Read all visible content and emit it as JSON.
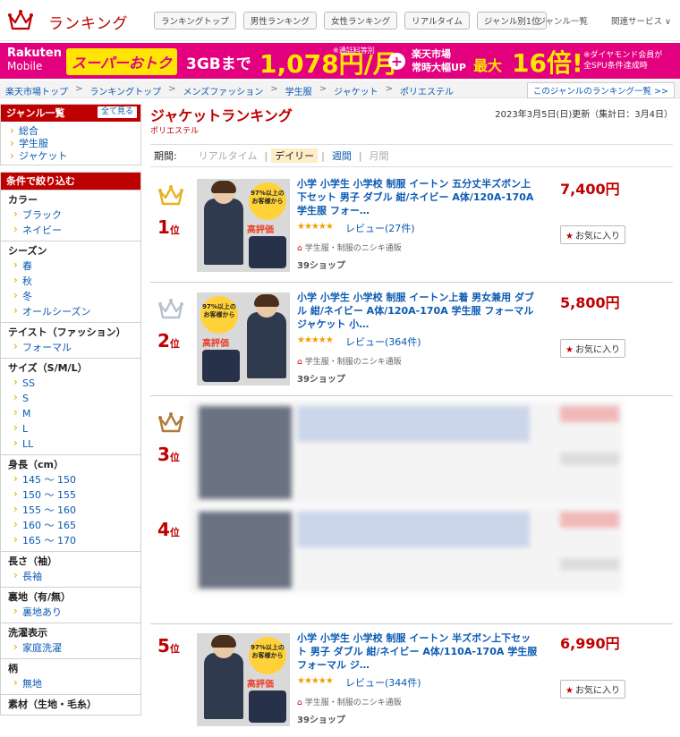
{
  "header": {
    "logo_text": "ランキング",
    "nav": [
      "ランキングトップ",
      "男性ランキング",
      "女性ランキング",
      "リアルタイム",
      "ジャンル別1位"
    ],
    "genre_list": "ジャンル一覧",
    "related": "関連サービス ∨"
  },
  "banner": {
    "mobile_line1": "Rakuten",
    "mobile_line2": "Mobile",
    "deal": "スーパーおトク",
    "gb": "3GBまで",
    "price": "1,078円/月",
    "note1": "※通話料等別",
    "plus": "+",
    "ichiba_line1": "楽天市場",
    "ichiba_line2": "常時大幅UP",
    "max": "最大",
    "times": "16倍!",
    "note2_line1": "※ダイヤモンド会員が",
    "note2_line2": "全SPU条件達成時"
  },
  "breadcrumb": {
    "items": [
      "楽天市場トップ",
      "ランキングトップ",
      "メンズファッション",
      "学生服",
      "ジャケット",
      "ポリエステル"
    ],
    "sep": ">",
    "genre_button": "このジャンルのランキング一覧 >>"
  },
  "sidebar": {
    "genre_title": "ジャンル一覧",
    "see_all": "全て見る",
    "genre_items": [
      "総合",
      "学生服",
      "ジャケット"
    ],
    "filter_title": "条件で絞り込む",
    "sections": [
      {
        "title": "カラー",
        "items": [
          "ブラック",
          "ネイビー"
        ]
      },
      {
        "title": "シーズン",
        "items": [
          "春",
          "秋",
          "冬",
          "オールシーズン"
        ]
      },
      {
        "title": "テイスト（ファッション）",
        "items": [
          "フォーマル"
        ]
      },
      {
        "title": "サイズ（S/M/L）",
        "items": [
          "SS",
          "S",
          "M",
          "L",
          "LL"
        ]
      },
      {
        "title": "身長（cm）",
        "items": [
          "145 ～ 150",
          "150 ～ 155",
          "155 ～ 160",
          "160 ～ 165",
          "165 ～ 170"
        ]
      },
      {
        "title": "長さ（袖）",
        "items": [
          "長袖"
        ]
      },
      {
        "title": "裏地（有/無）",
        "items": [
          "裏地あり"
        ]
      },
      {
        "title": "洗濯表示",
        "items": [
          "家庭洗濯"
        ]
      },
      {
        "title": "柄",
        "items": [
          "無地"
        ]
      },
      {
        "title": "素材（生地・毛糸）",
        "items": []
      }
    ]
  },
  "main": {
    "title": "ジャケットランキング",
    "subtitle": "ポリエステル",
    "updated": "2023年3月5日(日)更新（集計日：3月4日）",
    "period_label": "期間:",
    "periods": [
      "リアルタイム",
      "デイリー",
      "週間",
      "月間"
    ],
    "items": [
      {
        "rank": "1",
        "rank_suffix": "位",
        "title": "小学 小学生 小学校 制服 イートン 五分丈半ズボン上下セット 男子 ダブル 紺/ネイビー A体/120A-170A 学生服 フォー…",
        "stars": "★★★★★",
        "review": "レビュー(27件)",
        "shop": "学生服・制服のニシキ通販",
        "shop_logo": "39ショップ",
        "price": "7,400円",
        "fav": "お気に入り",
        "badge": "97%以上のお客様から",
        "badge2": "高評価",
        "crown": "gold"
      },
      {
        "rank": "2",
        "rank_suffix": "位",
        "title": "小学 小学生 小学校 制服 イートン上着 男女兼用 ダブル 紺/ネイビー A体/120A-170A 学生服 フォーマル ジャケット 小…",
        "stars": "★★★★★",
        "review": "レビュー(364件)",
        "shop": "学生服・制服のニシキ通販",
        "shop_logo": "39ショップ",
        "price": "5,800円",
        "fav": "お気に入り",
        "badge": "97%以上のお客様から",
        "badge2": "高評価",
        "crown": "silver"
      },
      {
        "rank": "3",
        "rank_suffix": "位",
        "crown": "bronze"
      },
      {
        "rank": "4",
        "rank_suffix": "位"
      },
      {
        "rank": "5",
        "rank_suffix": "位",
        "title": "小学 小学生 小学校 制服 イートン 半ズボン上下セット 男子 ダブル 紺/ネイビー A体/110A-170A 学生服 フォーマル ジ…",
        "stars": "★★★★★",
        "review": "レビュー(344件)",
        "shop": "学生服・制服のニシキ通販",
        "shop_logo": "39ショップ",
        "price": "6,990円",
        "fav": "お気に入り",
        "badge": "97%以上のお客様から",
        "badge2": "高評価"
      }
    ]
  },
  "colors": {
    "brand_red": "#bf0000",
    "link_blue": "#0b5ab3",
    "banner_pink": "#e3007f",
    "banner_yellow": "#ffe600",
    "gold": "#e6b422",
    "silver": "#b8c2cc",
    "bronze": "#b07a3a"
  }
}
